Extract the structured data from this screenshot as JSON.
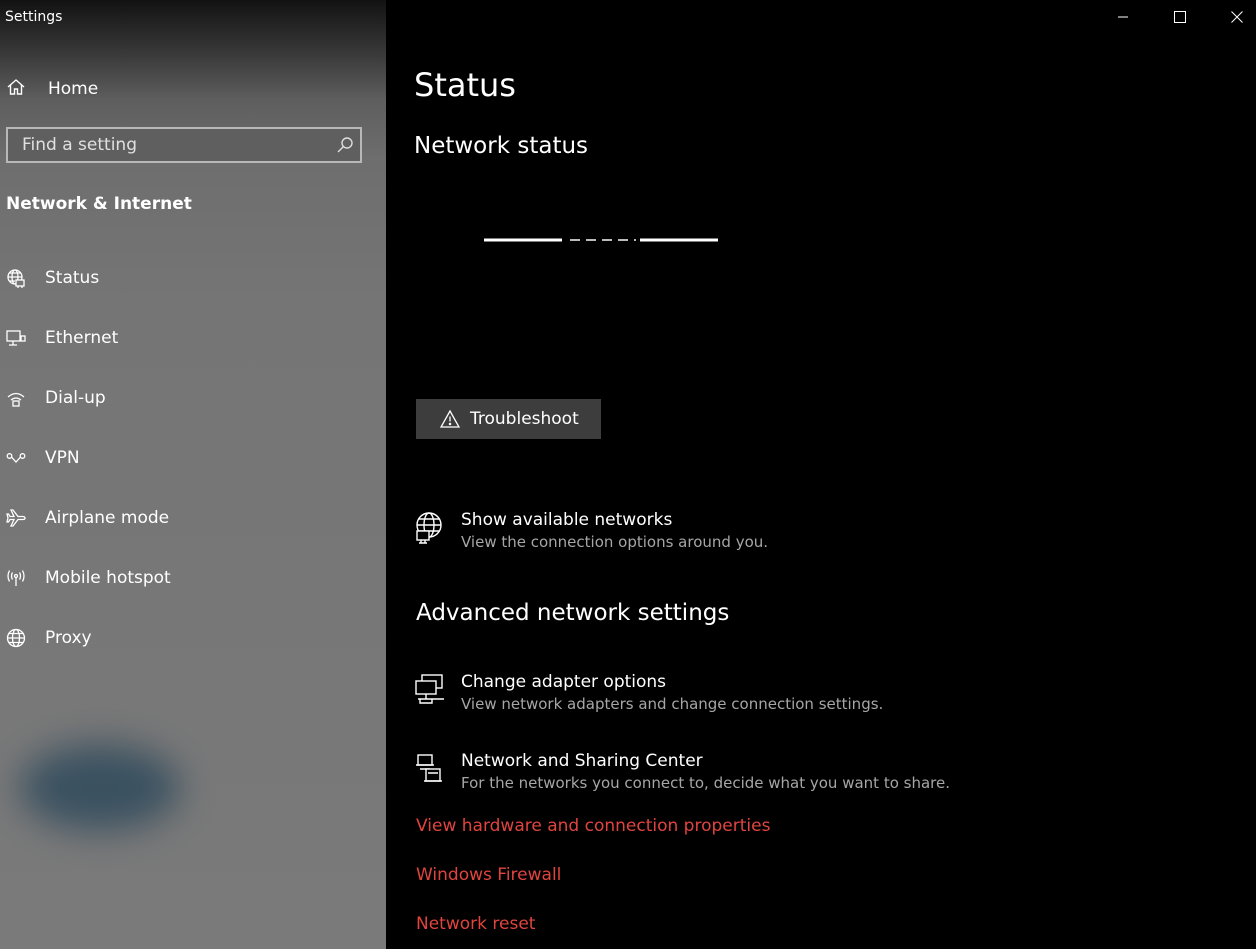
{
  "window": {
    "title": "Settings",
    "controls": [
      "minimize",
      "maximize",
      "close"
    ]
  },
  "sidebar": {
    "home_label": "Home",
    "search_placeholder": "Find a setting",
    "section_title": "Network & Internet",
    "items": [
      {
        "label": "Status",
        "icon": "status-globe-icon"
      },
      {
        "label": "Ethernet",
        "icon": "ethernet-icon"
      },
      {
        "label": "Dial-up",
        "icon": "dialup-icon"
      },
      {
        "label": "VPN",
        "icon": "vpn-icon"
      },
      {
        "label": "Airplane mode",
        "icon": "airplane-icon"
      },
      {
        "label": "Mobile hotspot",
        "icon": "hotspot-icon"
      },
      {
        "label": "Proxy",
        "icon": "globe-icon"
      }
    ]
  },
  "main": {
    "page_title": "Status",
    "network_status_heading": "Network status",
    "troubleshoot_label": "Troubleshoot",
    "show_networks": {
      "title": "Show available networks",
      "desc": "View the connection options around you."
    },
    "advanced_heading": "Advanced network settings",
    "change_adapter": {
      "title": "Change adapter options",
      "desc": "View network adapters and change connection settings."
    },
    "sharing_center": {
      "title": "Network and Sharing Center",
      "desc": "For the networks you connect to, decide what you want to share."
    },
    "links": [
      "View hardware and connection properties",
      "Windows Firewall",
      "Network reset"
    ]
  },
  "colors": {
    "link_red": "#e0443f",
    "sidebar_bg": "#777777",
    "main_bg": "#000000",
    "button_bg": "#3d3d3d"
  }
}
